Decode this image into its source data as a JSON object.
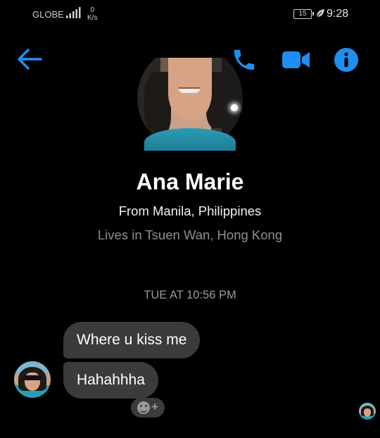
{
  "status_bar": {
    "carrier": "GLOBE",
    "net_speed_value": "0",
    "net_speed_unit": "K/s",
    "battery": "15",
    "time": "9:28"
  },
  "header": {
    "back_icon": "arrow-left-icon",
    "call_icon": "phone-icon",
    "video_icon": "video-camera-icon",
    "info_icon": "info-icon",
    "accent_color": "#1f8ef1"
  },
  "profile": {
    "name": "Ana Marie",
    "from": "From Manila, Philippines",
    "lives": "Lives in Tsuen Wan, Hong Kong"
  },
  "conversation": {
    "timestamp": "TUE AT 10:56 PM",
    "messages": [
      {
        "text": "Where u kiss me"
      },
      {
        "text": "Hahahhha"
      }
    ],
    "react_icon": "smiley-add-icon",
    "react_plus": "+",
    "bubble_color": "#3a3b3c"
  }
}
